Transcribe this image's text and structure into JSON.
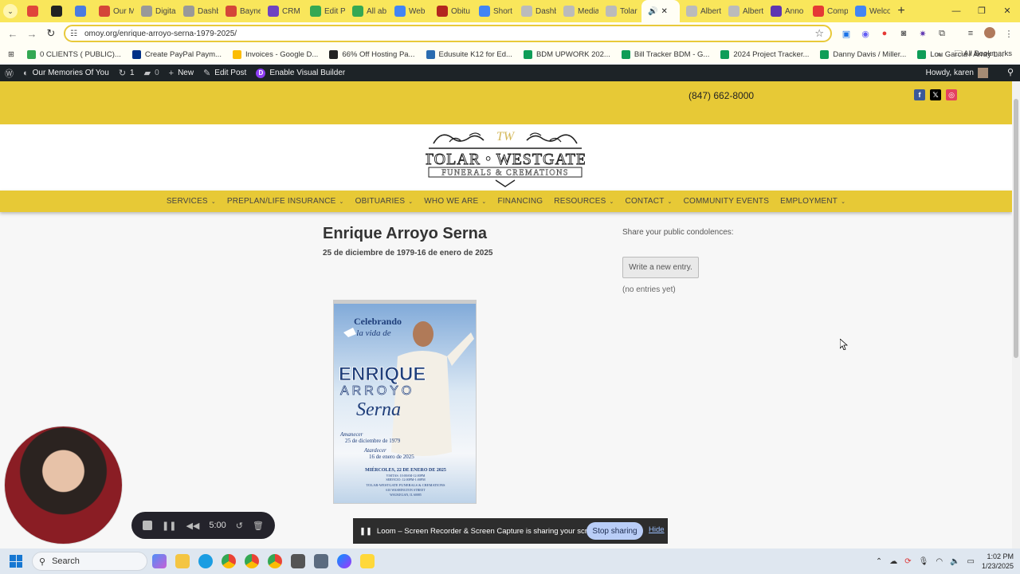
{
  "browser": {
    "tabs": [
      {
        "label": "",
        "color": "#e0453a"
      },
      {
        "label": "",
        "color": "#222222"
      },
      {
        "label": "",
        "color": "#4a7be0"
      },
      {
        "label": "Our M",
        "color": "#d44638"
      },
      {
        "label": "Digita",
        "color": "#999999"
      },
      {
        "label": "Dashb",
        "color": "#999999"
      },
      {
        "label": "Bayne",
        "color": "#d44638"
      },
      {
        "label": "CRM",
        "color": "#6f42c1"
      },
      {
        "label": "Edit P",
        "color": "#34a853"
      },
      {
        "label": "All ab",
        "color": "#34a853"
      },
      {
        "label": "Web",
        "color": "#4285f4"
      },
      {
        "label": "Obitu",
        "color": "#b3261e"
      },
      {
        "label": "Short",
        "color": "#4285f4"
      },
      {
        "label": "Dashb",
        "color": "#bbbbbb"
      },
      {
        "label": "Media",
        "color": "#bbbbbb"
      },
      {
        "label": "Tolar",
        "color": "#bbbbbb"
      }
    ],
    "active_tab": {
      "label": "",
      "close": "✕"
    },
    "tabs_after": [
      {
        "label": "Albert",
        "color": "#bbbbbb"
      },
      {
        "label": "Albert",
        "color": "#bbbbbb"
      },
      {
        "label": "Anno",
        "color": "#5e35b1"
      },
      {
        "label": "Comp",
        "color": "#e53935"
      },
      {
        "label": "Welco",
        "color": "#4285f4"
      }
    ],
    "url": "omoy.org/enrique-arroyo-serna-1979-2025/",
    "bookmarks": [
      {
        "label": "0 CLIENTS ( PUBLIC)...",
        "color": "#34a853"
      },
      {
        "label": "Create PayPal Paym...",
        "color": "#003087"
      },
      {
        "label": "Invoices - Google D...",
        "color": "#fbbc04"
      },
      {
        "label": "66% Off Hosting Pa...",
        "color": "#222222"
      },
      {
        "label": "Edusuite K12 for Ed...",
        "color": "#2b6cb0"
      },
      {
        "label": "BDM UPWORK 202...",
        "color": "#0f9d58"
      },
      {
        "label": "Bill Tracker BDM - G...",
        "color": "#0f9d58"
      },
      {
        "label": "2024 Project Tracker...",
        "color": "#0f9d58"
      },
      {
        "label": "Danny Davis / Miller...",
        "color": "#0f9d58"
      },
      {
        "label": "Lou Garcia / Array L...",
        "color": "#0f9d58"
      }
    ],
    "all_bookmarks": "All Bookmarks"
  },
  "wp_admin": {
    "site_name": "Our Memories Of You",
    "updates_count": "1",
    "comments_count": "0",
    "new_label": "New",
    "edit_post_label": "Edit Post",
    "visual_builder_label": "Enable Visual Builder",
    "howdy": "Howdy, karen"
  },
  "site": {
    "phone": "(847) 662-8000",
    "logo_line1": "TOLAR • WESTGATE",
    "logo_line2": "FUNERALS & CREMATIONS",
    "logo_initials": "TW",
    "nav": [
      {
        "label": "SERVICES",
        "dropdown": true
      },
      {
        "label": "PREPLAN/LIFE INSURANCE",
        "dropdown": true
      },
      {
        "label": "OBITUARIES",
        "dropdown": true
      },
      {
        "label": "WHO WE ARE",
        "dropdown": true
      },
      {
        "label": "FINANCING",
        "dropdown": false
      },
      {
        "label": "RESOURCES",
        "dropdown": true
      },
      {
        "label": "CONTACT",
        "dropdown": true
      },
      {
        "label": "COMMUNITY EVENTS",
        "dropdown": false
      },
      {
        "label": "EMPLOYMENT",
        "dropdown": true
      }
    ]
  },
  "obituary": {
    "name": "Enrique Arroyo Serna",
    "dates": "25 de diciembre de 1979-16 de enero de 2025",
    "flyer": {
      "celebrando": "Celebrando",
      "la_vida": "la vida de",
      "first": "ENRIQUE",
      "middle": "ARROYO",
      "last": "Serna",
      "amanecer": "Amanecer",
      "born": "25 de diciembre de 1979",
      "atardecer": "Atardecer",
      "died": "16 de enero de 2025",
      "service_date": "MIÉRCOLES, 22 DE ENERO DE 2025",
      "visitation": "VISITAS: 10:00AM-12:00PM",
      "service": "SERVICIO: 12:00PM-1:00PM",
      "home": "TOLAR-WESTGATE FUNERALS & CREMATIONS",
      "street": "610 WASHINGTON STREET",
      "city": "WAUKEGAN, IL 60085"
    }
  },
  "condolences": {
    "heading": "Share your public condolences:",
    "button": "Write a new entry.",
    "empty": "(no entries yet)"
  },
  "loom": {
    "timer": "5:00",
    "banner": "Loom – Screen Recorder & Screen Capture is sharing your screen and audio.",
    "stop_sharing": "Stop sharing",
    "hide": "Hide"
  },
  "taskbar": {
    "search_placeholder": "Search",
    "time": "1:02 PM",
    "date": "1/23/2025"
  },
  "colors": {
    "brand_yellow": "#e7c936",
    "tab_yellow": "#f9e65b"
  }
}
